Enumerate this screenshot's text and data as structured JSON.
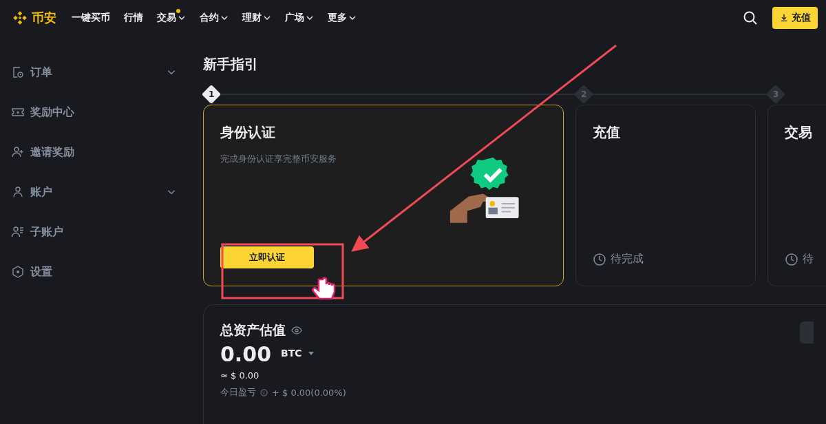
{
  "brand": {
    "name": "币安"
  },
  "nav": [
    {
      "label": "一键买币",
      "dropdown": false,
      "dot": false
    },
    {
      "label": "行情",
      "dropdown": false,
      "dot": false
    },
    {
      "label": "交易",
      "dropdown": true,
      "dot": true
    },
    {
      "label": "合约",
      "dropdown": true,
      "dot": false
    },
    {
      "label": "理财",
      "dropdown": true,
      "dot": false
    },
    {
      "label": "广场",
      "dropdown": true,
      "dot": false
    },
    {
      "label": "更多",
      "dropdown": true,
      "dot": false
    }
  ],
  "deposit_button": {
    "label": "充值"
  },
  "sidebar": {
    "items": [
      {
        "kind": "orders",
        "label": "订单",
        "expandable": true
      },
      {
        "kind": "rewards",
        "label": "奖励中心",
        "expandable": false
      },
      {
        "kind": "invite",
        "label": "邀请奖励",
        "expandable": false
      },
      {
        "kind": "account",
        "label": "账户",
        "expandable": true
      },
      {
        "kind": "subaccount",
        "label": "子账户",
        "expandable": false
      },
      {
        "kind": "settings",
        "label": "设置",
        "expandable": false
      }
    ]
  },
  "guide": {
    "title": "新手指引",
    "steps": [
      {
        "number": "1",
        "selected": true
      },
      {
        "number": "2",
        "selected": false
      },
      {
        "number": "3",
        "selected": false
      }
    ],
    "cards": [
      {
        "kind": "current",
        "title": "身份认证",
        "description": "完成身份认证享完整币安服务",
        "button": "立即认证"
      },
      {
        "kind": "pending",
        "title": "充值",
        "status": "待完成"
      },
      {
        "kind": "pending",
        "title": "交易",
        "status": "待"
      }
    ]
  },
  "assets": {
    "title": "总资产估值",
    "amount": "0.00",
    "currency": "BTC",
    "fiat": "≈ $ 0.00",
    "pnl_label": "今日盈亏",
    "pnl_value": "+ $ 0.00(0.00%)"
  }
}
